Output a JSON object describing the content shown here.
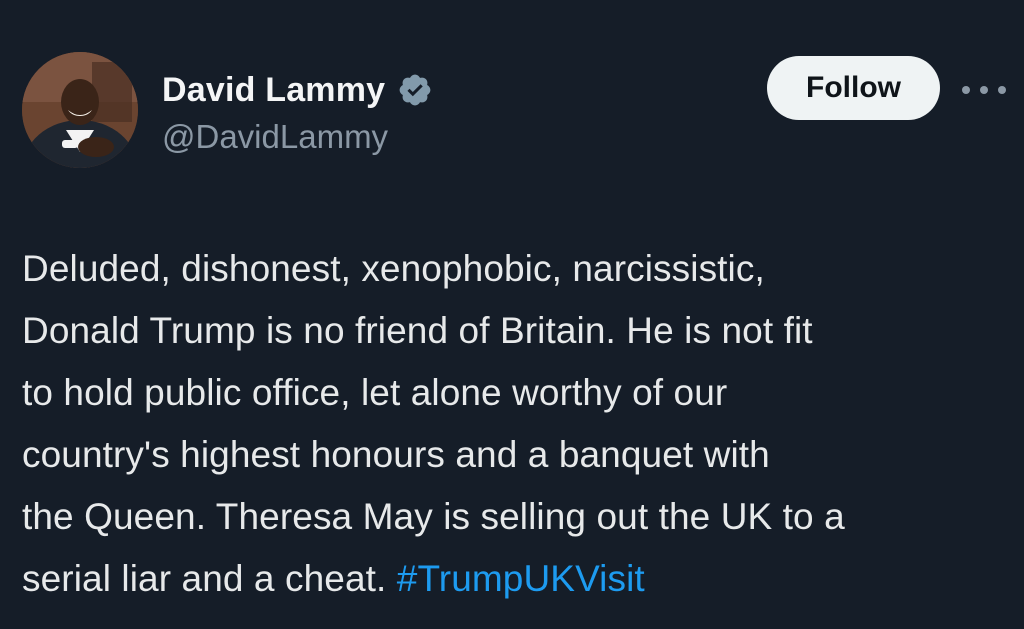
{
  "author": {
    "display_name": "David Lammy",
    "handle": "@DavidLammy",
    "verified": true
  },
  "actions": {
    "follow_label": "Follow",
    "more_icon": "more-horizontal-icon"
  },
  "tweet": {
    "lines": [
      "Deluded, dishonest, xenophobic, narcissistic,",
      "Donald Trump is no friend of Britain. He is not fit",
      "to hold public office, let alone worthy of our",
      "country's highest honours and a banquet with",
      "the Queen. Theresa May is selling out the UK to a",
      "serial liar and a cheat. "
    ],
    "hashtag": "#TrumpUKVisit"
  },
  "colors": {
    "background": "#151d28",
    "text": "#e7e9ea",
    "secondary_text": "#8b98a5",
    "link": "#1d9bf0",
    "button_bg": "#eff3f4"
  }
}
